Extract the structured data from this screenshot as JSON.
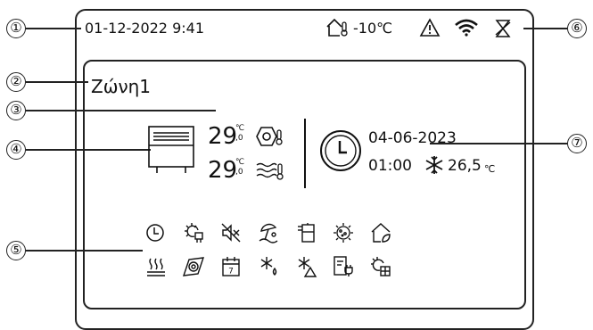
{
  "callouts": [
    "①",
    "②",
    "③",
    "④",
    "⑤",
    "⑥",
    "⑦"
  ],
  "status_bar": {
    "datetime": "01-12-2022 9:41",
    "outdoor_temp": "-10℃",
    "icons": [
      "home-thermometer-icon",
      "warning-icon",
      "wifi-icon",
      "defrost-icon"
    ]
  },
  "zone": {
    "name": "Ζώνη1",
    "water_temp": {
      "value": "29",
      "decimal": ",0",
      "unit": "℃"
    },
    "room_temp": {
      "value": "29",
      "decimal": ",0",
      "unit": "℃"
    }
  },
  "schedule": {
    "date": "04-06-2023",
    "time": "01:00",
    "temp_value": "26,5",
    "temp_unit": "℃"
  },
  "function_icons": {
    "row1": [
      "timer-icon",
      "solar-heater-icon",
      "silent-mode-icon",
      "vacation-icon",
      "tank-heater-icon",
      "sterilize-icon",
      "eco-home-icon"
    ],
    "row2": [
      "floor-heating-icon",
      "pump-icon",
      "weekly-schedule-icon",
      "anti-freeze-icon",
      "snow-alarm-icon",
      "smart-grid-icon",
      "electric-heater-icon"
    ],
    "calendar_day": "7"
  }
}
